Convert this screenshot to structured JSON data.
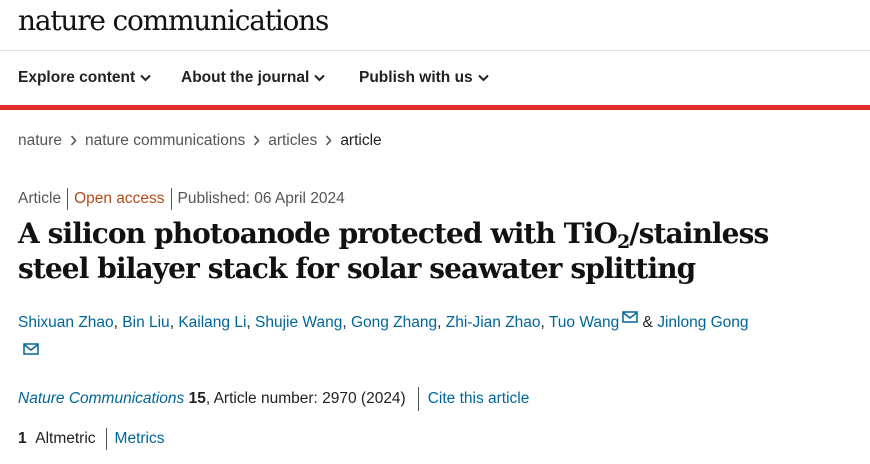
{
  "site": {
    "logo": "nature communications"
  },
  "nav": {
    "explore": "Explore content",
    "about": "About the journal",
    "publish": "Publish with us"
  },
  "breadcrumb": [
    "nature",
    "nature communications",
    "articles",
    "article"
  ],
  "meta": {
    "type": "Article",
    "access": "Open access",
    "published": "Published: 06 April 2024"
  },
  "title": {
    "part1": "A silicon photoanode protected with TiO",
    "subscript": "2",
    "part2": "/stainless steel bilayer stack for solar seawater splitting"
  },
  "authors": [
    "Shixuan Zhao",
    "Bin Liu",
    "Kailang Li",
    "Shujie Wang",
    "Gong Zhang",
    "Zhi-Jian Zhao",
    "Tuo Wang",
    "Jinlong Gong"
  ],
  "authors_joiner": "&",
  "citation": {
    "journal": "Nature Communications",
    "volume": "15",
    "article_number": ", Article number: 2970 (2024)",
    "cite_link": "Cite this article"
  },
  "metrics": {
    "altmetric_count": "1",
    "altmetric_label": "Altmetric",
    "metrics_link": "Metrics"
  },
  "colors": {
    "accent_red": "#e0302b",
    "link": "#006699",
    "open_access": "#b34a1a"
  },
  "icons": [
    "chevron-down-icon",
    "chevron-right-icon",
    "envelope-icon"
  ]
}
